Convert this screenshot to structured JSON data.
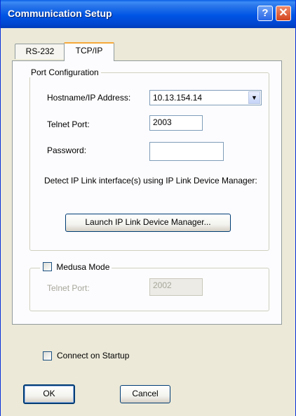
{
  "window": {
    "title": "Communication Setup",
    "help_glyph": "?",
    "close_glyph": "✕"
  },
  "tabs": [
    {
      "label": "RS-232",
      "active": false
    },
    {
      "label": "TCP/IP",
      "active": true
    }
  ],
  "port_config": {
    "legend": "Port Configuration",
    "hostname_label": "Hostname/IP Address:",
    "hostname_value": "10.13.154.14",
    "dropdown_arrow": "▼",
    "telnet_label": "Telnet Port:",
    "telnet_value": "2003",
    "password_label": "Password:",
    "password_value": "",
    "detect_text": "Detect IP Link interface(s) using IP Link Device Manager:",
    "launch_button": "Launch IP Link Device Manager..."
  },
  "medusa": {
    "checkbox_label": "Medusa Mode",
    "checked": false,
    "telnet_label": "Telnet Port:",
    "telnet_value": "2002"
  },
  "connect_on_startup": {
    "label": "Connect on Startup",
    "checked": false
  },
  "buttons": {
    "ok": "OK",
    "cancel": "Cancel"
  }
}
